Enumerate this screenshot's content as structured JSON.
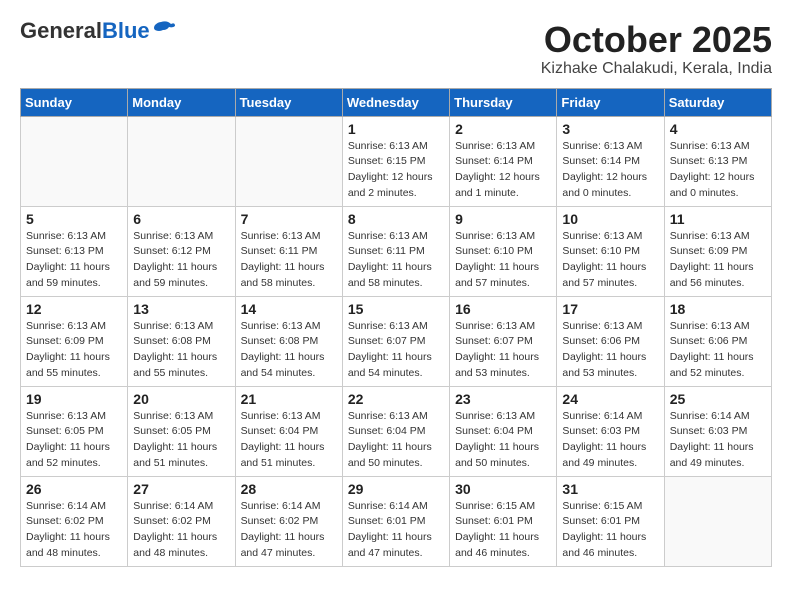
{
  "header": {
    "logo_general": "General",
    "logo_blue": "Blue",
    "month": "October 2025",
    "location": "Kizhake Chalakudi, Kerala, India"
  },
  "weekdays": [
    "Sunday",
    "Monday",
    "Tuesday",
    "Wednesday",
    "Thursday",
    "Friday",
    "Saturday"
  ],
  "weeks": [
    [
      {
        "day": "",
        "info": ""
      },
      {
        "day": "",
        "info": ""
      },
      {
        "day": "",
        "info": ""
      },
      {
        "day": "1",
        "info": "Sunrise: 6:13 AM\nSunset: 6:15 PM\nDaylight: 12 hours\nand 2 minutes."
      },
      {
        "day": "2",
        "info": "Sunrise: 6:13 AM\nSunset: 6:14 PM\nDaylight: 12 hours\nand 1 minute."
      },
      {
        "day": "3",
        "info": "Sunrise: 6:13 AM\nSunset: 6:14 PM\nDaylight: 12 hours\nand 0 minutes."
      },
      {
        "day": "4",
        "info": "Sunrise: 6:13 AM\nSunset: 6:13 PM\nDaylight: 12 hours\nand 0 minutes."
      }
    ],
    [
      {
        "day": "5",
        "info": "Sunrise: 6:13 AM\nSunset: 6:13 PM\nDaylight: 11 hours\nand 59 minutes."
      },
      {
        "day": "6",
        "info": "Sunrise: 6:13 AM\nSunset: 6:12 PM\nDaylight: 11 hours\nand 59 minutes."
      },
      {
        "day": "7",
        "info": "Sunrise: 6:13 AM\nSunset: 6:11 PM\nDaylight: 11 hours\nand 58 minutes."
      },
      {
        "day": "8",
        "info": "Sunrise: 6:13 AM\nSunset: 6:11 PM\nDaylight: 11 hours\nand 58 minutes."
      },
      {
        "day": "9",
        "info": "Sunrise: 6:13 AM\nSunset: 6:10 PM\nDaylight: 11 hours\nand 57 minutes."
      },
      {
        "day": "10",
        "info": "Sunrise: 6:13 AM\nSunset: 6:10 PM\nDaylight: 11 hours\nand 57 minutes."
      },
      {
        "day": "11",
        "info": "Sunrise: 6:13 AM\nSunset: 6:09 PM\nDaylight: 11 hours\nand 56 minutes."
      }
    ],
    [
      {
        "day": "12",
        "info": "Sunrise: 6:13 AM\nSunset: 6:09 PM\nDaylight: 11 hours\nand 55 minutes."
      },
      {
        "day": "13",
        "info": "Sunrise: 6:13 AM\nSunset: 6:08 PM\nDaylight: 11 hours\nand 55 minutes."
      },
      {
        "day": "14",
        "info": "Sunrise: 6:13 AM\nSunset: 6:08 PM\nDaylight: 11 hours\nand 54 minutes."
      },
      {
        "day": "15",
        "info": "Sunrise: 6:13 AM\nSunset: 6:07 PM\nDaylight: 11 hours\nand 54 minutes."
      },
      {
        "day": "16",
        "info": "Sunrise: 6:13 AM\nSunset: 6:07 PM\nDaylight: 11 hours\nand 53 minutes."
      },
      {
        "day": "17",
        "info": "Sunrise: 6:13 AM\nSunset: 6:06 PM\nDaylight: 11 hours\nand 53 minutes."
      },
      {
        "day": "18",
        "info": "Sunrise: 6:13 AM\nSunset: 6:06 PM\nDaylight: 11 hours\nand 52 minutes."
      }
    ],
    [
      {
        "day": "19",
        "info": "Sunrise: 6:13 AM\nSunset: 6:05 PM\nDaylight: 11 hours\nand 52 minutes."
      },
      {
        "day": "20",
        "info": "Sunrise: 6:13 AM\nSunset: 6:05 PM\nDaylight: 11 hours\nand 51 minutes."
      },
      {
        "day": "21",
        "info": "Sunrise: 6:13 AM\nSunset: 6:04 PM\nDaylight: 11 hours\nand 51 minutes."
      },
      {
        "day": "22",
        "info": "Sunrise: 6:13 AM\nSunset: 6:04 PM\nDaylight: 11 hours\nand 50 minutes."
      },
      {
        "day": "23",
        "info": "Sunrise: 6:13 AM\nSunset: 6:04 PM\nDaylight: 11 hours\nand 50 minutes."
      },
      {
        "day": "24",
        "info": "Sunrise: 6:14 AM\nSunset: 6:03 PM\nDaylight: 11 hours\nand 49 minutes."
      },
      {
        "day": "25",
        "info": "Sunrise: 6:14 AM\nSunset: 6:03 PM\nDaylight: 11 hours\nand 49 minutes."
      }
    ],
    [
      {
        "day": "26",
        "info": "Sunrise: 6:14 AM\nSunset: 6:02 PM\nDaylight: 11 hours\nand 48 minutes."
      },
      {
        "day": "27",
        "info": "Sunrise: 6:14 AM\nSunset: 6:02 PM\nDaylight: 11 hours\nand 48 minutes."
      },
      {
        "day": "28",
        "info": "Sunrise: 6:14 AM\nSunset: 6:02 PM\nDaylight: 11 hours\nand 47 minutes."
      },
      {
        "day": "29",
        "info": "Sunrise: 6:14 AM\nSunset: 6:01 PM\nDaylight: 11 hours\nand 47 minutes."
      },
      {
        "day": "30",
        "info": "Sunrise: 6:15 AM\nSunset: 6:01 PM\nDaylight: 11 hours\nand 46 minutes."
      },
      {
        "day": "31",
        "info": "Sunrise: 6:15 AM\nSunset: 6:01 PM\nDaylight: 11 hours\nand 46 minutes."
      },
      {
        "day": "",
        "info": ""
      }
    ]
  ]
}
